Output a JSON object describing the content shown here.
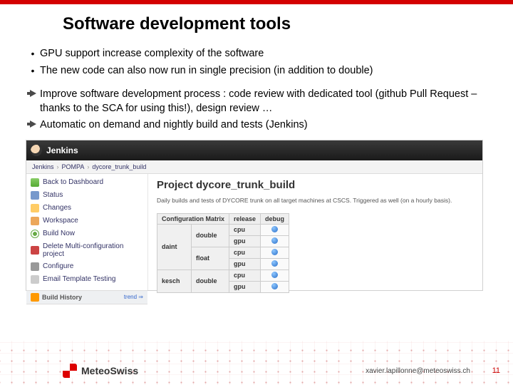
{
  "title": "Software development tools",
  "bullets_plain": [
    "GPU support increase complexity of the software",
    "The new code can also now run in single precision (in addition to double)"
  ],
  "bullets_arrow": [
    "Improve software development process : code review with dedicated tool (github Pull Request – thanks to the SCA for using this!), design review …",
    "Automatic on demand and nightly build and tests (Jenkins)"
  ],
  "jenkins": {
    "logo_text": "Jenkins",
    "breadcrumb": [
      "Jenkins",
      "POMPA",
      "dycore_trunk_build"
    ],
    "sidebar": [
      {
        "icon": "up",
        "label": "Back to Dashboard"
      },
      {
        "icon": "status",
        "label": "Status"
      },
      {
        "icon": "changes",
        "label": "Changes"
      },
      {
        "icon": "ws",
        "label": "Workspace"
      },
      {
        "icon": "build",
        "label": "Build Now"
      },
      {
        "icon": "del",
        "label": "Delete Multi-configuration project"
      },
      {
        "icon": "conf",
        "label": "Configure"
      },
      {
        "icon": "mail",
        "label": "Email Template Testing"
      }
    ],
    "history_title": "Build History",
    "history_trend": "trend ⇒",
    "project_title": "Project dycore_trunk_build",
    "project_desc": "Daily builds and tests of DYCORE trunk on all target machines at CSCS. Triggered as well (on a hourly basis).",
    "matrix": {
      "head": [
        "Configuration Matrix",
        "release",
        "debug"
      ],
      "rows": [
        {
          "host": "daint",
          "cfgs": [
            "double",
            "float"
          ],
          "targets": [
            "cpu",
            "gpu",
            "cpu",
            "gpu"
          ]
        },
        {
          "host": "kesch",
          "cfgs": [
            "double"
          ],
          "targets": [
            "cpu",
            "gpu"
          ]
        }
      ]
    }
  },
  "footer": {
    "brand": "MeteoSwiss",
    "email": "xavier.lapillonne@meteoswiss.ch",
    "page": "11"
  }
}
